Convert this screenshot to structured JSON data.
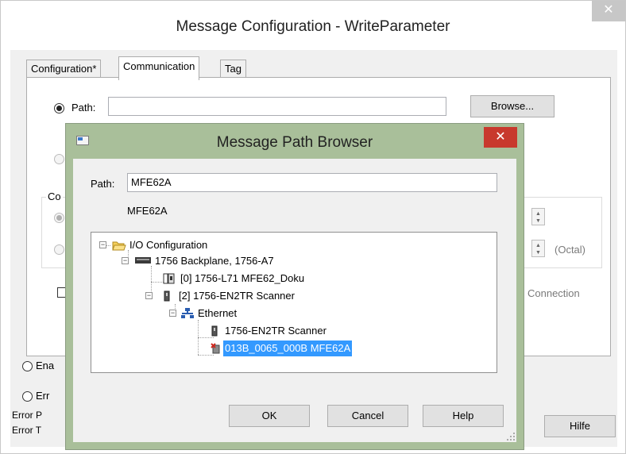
{
  "outer": {
    "title": "Message Configuration - WriteParameter",
    "close_label": "✕",
    "tabs": [
      {
        "label": "Configuration*"
      },
      {
        "label": "Communication"
      },
      {
        "label": "Tag"
      }
    ],
    "path_label": "Path:",
    "path_value": "",
    "browse_label": "Browse...",
    "group_label_partial": "Co",
    "octal_label": "(Octal)",
    "connection_label": "Connection",
    "enable_label_partial": "Ena",
    "error_label_partial": "Err",
    "error_p_partial": "Error P",
    "error_t_partial": "Error T",
    "hilfe_label": "Hilfe"
  },
  "modal": {
    "title": "Message Path Browser",
    "close_label": "✕",
    "path_label": "Path:",
    "path_value": "MFE62A",
    "path_display": "MFE62A",
    "tree": [
      {
        "label": "I/O Configuration"
      },
      {
        "label": "1756 Backplane, 1756-A7"
      },
      {
        "label": "[0] 1756-L71 MFE62_Doku"
      },
      {
        "label": "[2] 1756-EN2TR Scanner"
      },
      {
        "label": "Ethernet"
      },
      {
        "label": "1756-EN2TR Scanner"
      },
      {
        "label": "013B_0065_000B MFE62A"
      }
    ],
    "ok_label": "OK",
    "cancel_label": "Cancel",
    "help_label": "Help"
  }
}
